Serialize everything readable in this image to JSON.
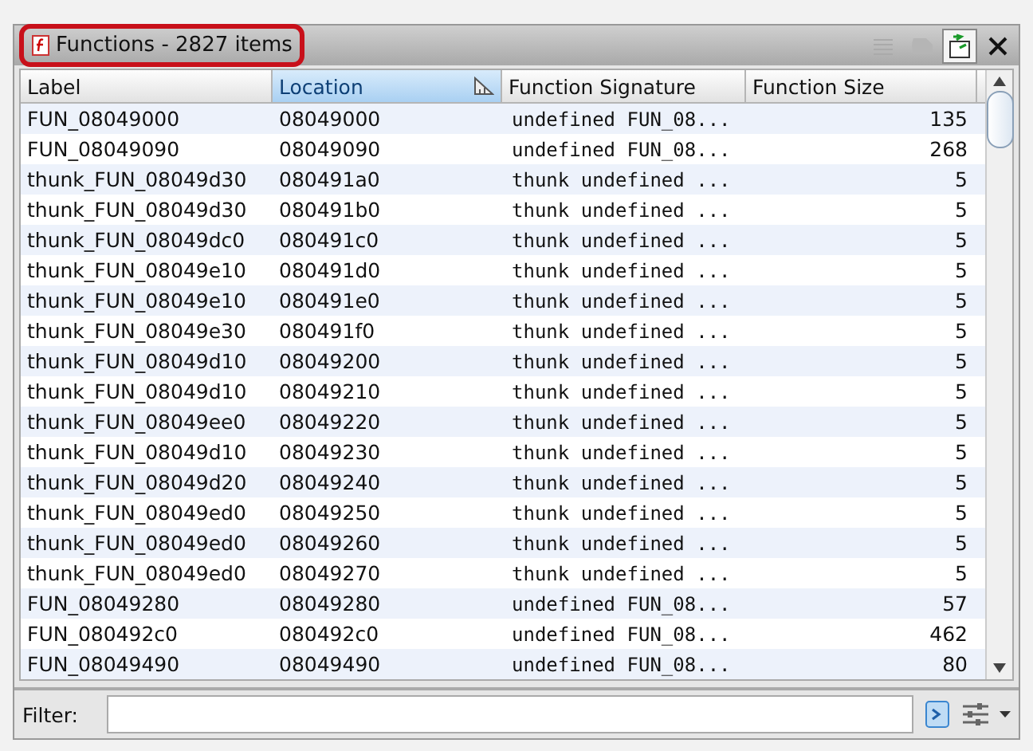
{
  "window": {
    "title": "Functions - 2827 items",
    "title_highlighted": true
  },
  "toolbar": [
    {
      "kind": "list",
      "disabled": true,
      "pressed": false
    },
    {
      "kind": "snapshot",
      "disabled": true,
      "pressed": false
    },
    {
      "kind": "export",
      "disabled": false,
      "pressed": true
    },
    {
      "kind": "close",
      "disabled": false,
      "pressed": false
    }
  ],
  "table": {
    "columns": [
      {
        "label": "Label",
        "sorted": false
      },
      {
        "label": "Location",
        "sorted": true
      },
      {
        "label": "Function Signature",
        "sorted": false
      },
      {
        "label": "Function Size",
        "sorted": false
      }
    ],
    "rows": [
      [
        "FUN_08049000",
        "08049000",
        "undefined FUN_08...",
        "135"
      ],
      [
        "FUN_08049090",
        "08049090",
        "undefined FUN_08...",
        "268"
      ],
      [
        "thunk_FUN_08049d30",
        "080491a0",
        "thunk undefined ...",
        "5"
      ],
      [
        "thunk_FUN_08049d30",
        "080491b0",
        "thunk undefined ...",
        "5"
      ],
      [
        "thunk_FUN_08049dc0",
        "080491c0",
        "thunk undefined ...",
        "5"
      ],
      [
        "thunk_FUN_08049e10",
        "080491d0",
        "thunk undefined ...",
        "5"
      ],
      [
        "thunk_FUN_08049e10",
        "080491e0",
        "thunk undefined ...",
        "5"
      ],
      [
        "thunk_FUN_08049e30",
        "080491f0",
        "thunk undefined ...",
        "5"
      ],
      [
        "thunk_FUN_08049d10",
        "08049200",
        "thunk undefined ...",
        "5"
      ],
      [
        "thunk_FUN_08049d10",
        "08049210",
        "thunk undefined ...",
        "5"
      ],
      [
        "thunk_FUN_08049ee0",
        "08049220",
        "thunk undefined ...",
        "5"
      ],
      [
        "thunk_FUN_08049d10",
        "08049230",
        "thunk undefined ...",
        "5"
      ],
      [
        "thunk_FUN_08049d20",
        "08049240",
        "thunk undefined ...",
        "5"
      ],
      [
        "thunk_FUN_08049ed0",
        "08049250",
        "thunk undefined ...",
        "5"
      ],
      [
        "thunk_FUN_08049ed0",
        "08049260",
        "thunk undefined ...",
        "5"
      ],
      [
        "thunk_FUN_08049ed0",
        "08049270",
        "thunk undefined ...",
        "5"
      ],
      [
        "FUN_08049280",
        "08049280",
        "undefined FUN_08...",
        "57"
      ],
      [
        "FUN_080492c0",
        "080492c0",
        "undefined FUN_08...",
        "462"
      ],
      [
        "FUN_08049490",
        "08049490",
        "undefined FUN_08...",
        "80"
      ]
    ]
  },
  "filter": {
    "label": "Filter:"
  }
}
